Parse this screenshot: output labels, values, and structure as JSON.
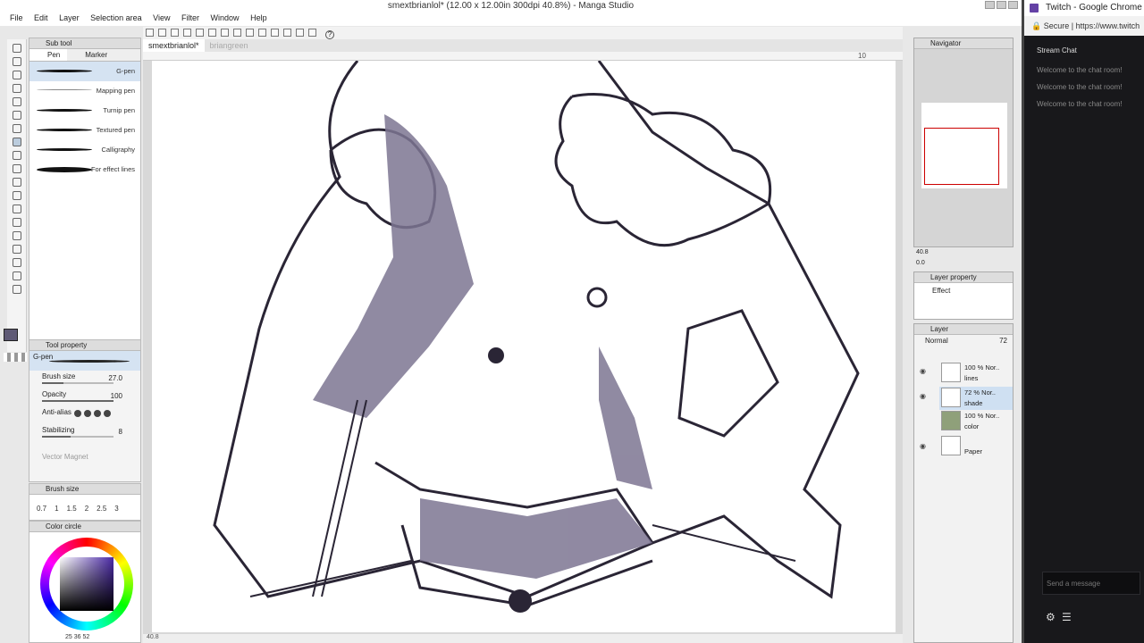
{
  "window": {
    "title": "smextbrianlol* (12.00 x 12.00in 300dpi 40.8%) - Manga Studio"
  },
  "menu": [
    "File",
    "Edit",
    "Layer",
    "Selection area",
    "View",
    "Filter",
    "Window",
    "Help"
  ],
  "subtool_panel": {
    "title": "Sub tool",
    "tabs": [
      "Pen",
      "Marker"
    ],
    "brushes": [
      "G-pen",
      "Mapping pen",
      "Turnip pen",
      "Textured pen",
      "Calligraphy",
      "For effect lines"
    ]
  },
  "tool_property": {
    "title": "Tool property",
    "brush_name": "G-pen",
    "brush_size_label": "Brush size",
    "brush_size_value": "27.0",
    "brush_size_fraction": 0.3,
    "opacity_label": "Opacity",
    "opacity_value": "100",
    "opacity_fraction": 1.0,
    "antialias_label": "Anti-alias",
    "stabilizing_label": "Stabilizing",
    "stabilizing_value": "8",
    "stabilizing_fraction": 0.4,
    "vector_magnet_label": "Vector Magnet"
  },
  "brush_size_panel": {
    "title": "Brush size",
    "values": [
      "0.7",
      "1",
      "1.5",
      "2",
      "2.5",
      "3"
    ]
  },
  "color_panel": {
    "title": "Color circle",
    "footer": "25  36  52",
    "current_color": "#5f5a76"
  },
  "canvas": {
    "tabs": [
      "smextbrianlol*",
      "briangreen"
    ],
    "ruler_label": "10",
    "status_zoom": "40.8"
  },
  "navigator": {
    "title": "Navigator",
    "zoom": "40.8",
    "angle": "0.0"
  },
  "layer_property": {
    "title": "Layer property",
    "effect_label": "Effect"
  },
  "layer_panel": {
    "title": "Layer",
    "blend_mode": "Normal",
    "opacity": "72",
    "layers": [
      {
        "opacity": "100 %  Nor..",
        "name": "lines"
      },
      {
        "opacity": "72 %  Nor..",
        "name": "shade"
      },
      {
        "opacity": "100 %  Nor..",
        "name": "color"
      },
      {
        "opacity": "",
        "name": "Paper"
      }
    ]
  },
  "chrome": {
    "title": "Twitch - Google Chrome",
    "secure": "Secure",
    "url": "https://www.twitch",
    "chat_title": "Stream Chat",
    "messages": [
      "Welcome to the chat room!",
      "Welcome to the chat room!",
      "Welcome to the chat room!"
    ],
    "send_placeholder": "Send a message"
  }
}
